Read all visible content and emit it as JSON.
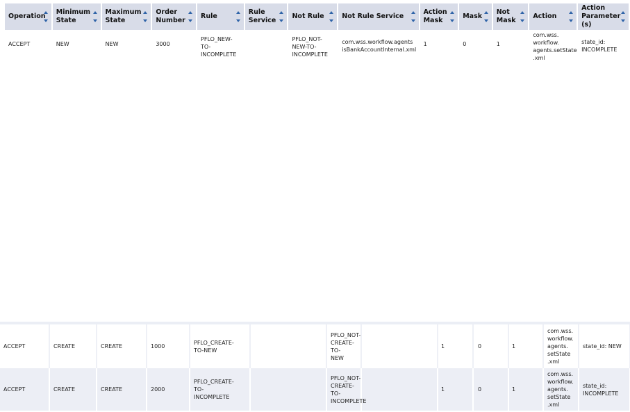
{
  "columns": [
    "Operation",
    "Minimum\nState",
    "Maximum\nState",
    "Order\nNumber",
    "Rule",
    "Rule\nService",
    "Not Rule",
    "Not Rule Service",
    "Action\nMask",
    "Mask",
    "Not\nMask",
    "Action",
    "Action\nParameter\n(s)"
  ],
  "top_row": {
    "operation": "ACCEPT",
    "minimum_state": "NEW",
    "maximum_state": "NEW",
    "order_number": "3000",
    "rule": "PFLO_NEW-\nTO-\nINCOMPLETE",
    "rule_service": "",
    "not_rule": "PFLO_NOT-\nNEW-TO-\nINCOMPLETE",
    "not_rule_service": "com.wss.workflow.agents\nisBankAccountInternal.xml",
    "action_mask": "1",
    "mask": "0",
    "not_mask": "1",
    "action": "com.wss.\nworkflow.\nagents.setState\n.xml",
    "action_parameters": "state_id:\nINCOMPLETE"
  },
  "bottom_rows": [
    {
      "operation": "ACCEPT",
      "minimum_state": "CREATE",
      "maximum_state": "CREATE",
      "order_number": "1000",
      "rule": "PFLO_CREATE-\nTO-NEW",
      "rule_service": "",
      "not_rule": "PFLO_NOT-\nCREATE-TO-\nNEW",
      "not_rule_service": "",
      "action_mask": "1",
      "mask": "0",
      "not_mask": "1",
      "action": "com.wss.\nworkflow.\nagents.\nsetState\n.xml",
      "action_parameters": "state_id: NEW"
    },
    {
      "operation": "ACCEPT",
      "minimum_state": "CREATE",
      "maximum_state": "CREATE",
      "order_number": "2000",
      "rule": "PFLO_CREATE-\nTO-\nINCOMPLETE",
      "rule_service": "",
      "not_rule": "PFLO_NOT-\nCREATE-TO-\nINCOMPLETE",
      "not_rule_service": "",
      "action_mask": "1",
      "mask": "0",
      "not_mask": "1",
      "action": "com.wss.\nworkflow.\nagents.\nsetState\n.xml",
      "action_parameters": "state_id:\nINCOMPLETE"
    }
  ],
  "colors": {
    "header_bg": "#d8dce8",
    "sort_arrow": "#2e63a8",
    "alt_row_bg": "#eceef5"
  },
  "icons": {
    "sort_asc": "triangle-up",
    "sort_desc": "triangle-down"
  }
}
